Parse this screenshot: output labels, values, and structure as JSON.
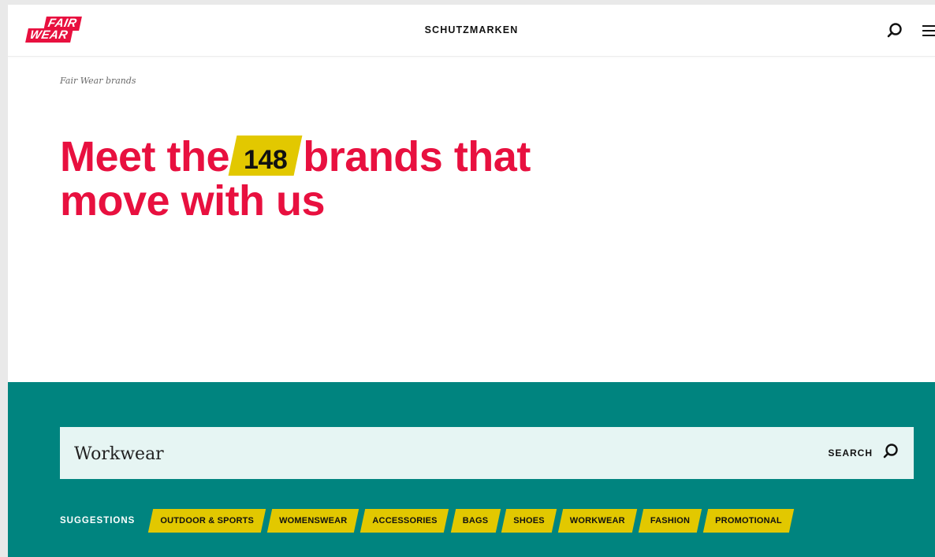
{
  "header": {
    "logo_top": "FAIR",
    "logo_bottom": "WEAR",
    "nav_title": "SCHUTZMARKEN"
  },
  "breadcrumb": "Fair Wear brands",
  "headline": {
    "before": "Meet the",
    "count": "148",
    "after_line1": "brands that",
    "line2": "move with us"
  },
  "search": {
    "value": "Workwear",
    "button_label": "SEARCH"
  },
  "suggestions": {
    "label": "SUGGESTIONS",
    "items": [
      "OUTDOOR & SPORTS",
      "WOMENSWEAR",
      "ACCESSORIES",
      "BAGS",
      "SHOES",
      "WORKWEAR",
      "FASHION",
      "PROMOTIONAL"
    ]
  },
  "colors": {
    "accent": "#e8103f",
    "teal": "#00847f",
    "chip": "#e2c800"
  }
}
